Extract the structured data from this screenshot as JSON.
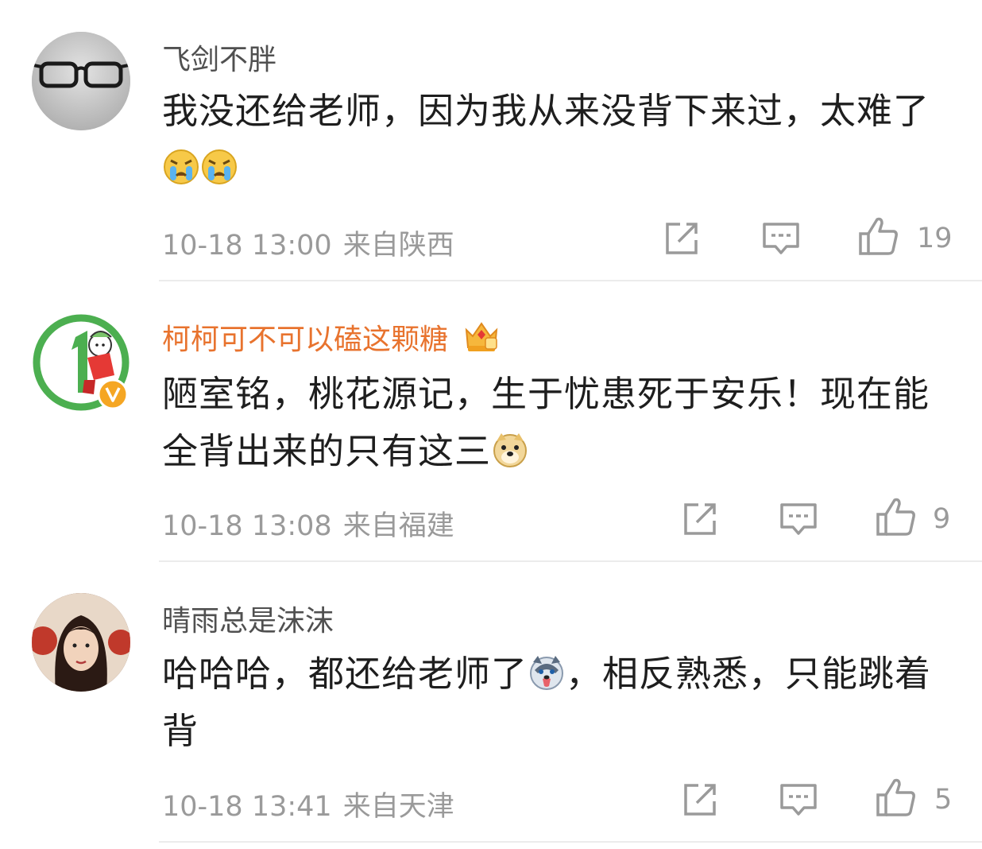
{
  "comments": [
    {
      "username": "飞剑不胖",
      "text_before": "我没还给老师，因为我从来没背下来过，太难了",
      "text_after": "",
      "emoji_names": [
        "crying-emoji",
        "crying-emoji"
      ],
      "timestamp": "10-18 13:00",
      "source": "来自陕西",
      "likes": "19",
      "verified": false
    },
    {
      "username": "柯柯可不可以磕这颗糖",
      "text_before": "陋室铭，桃花源记，生于忧患死于安乐！现在能全背出来的只有这三",
      "text_after": "",
      "emoji_names": [
        "doge-emoji"
      ],
      "timestamp": "10-18 13:08",
      "source": "来自福建",
      "likes": "9",
      "verified": true,
      "badge_icon": "crown-vip-icon"
    },
    {
      "username": "晴雨总是沫沫",
      "text_before": "哈哈哈，都还给老师了",
      "text_after": "，相反熟悉，只能跳着背",
      "emoji_names": [
        "husky-emoji"
      ],
      "timestamp": "10-18 13:41",
      "source": "来自天津",
      "likes": "5",
      "verified": false
    }
  ],
  "colors": {
    "vip_username": "#e8732e",
    "username": "#505050",
    "text": "#1e1e1e",
    "meta": "#9a9a9a",
    "divider": "#ececec",
    "icon": "#9a9a9a"
  }
}
